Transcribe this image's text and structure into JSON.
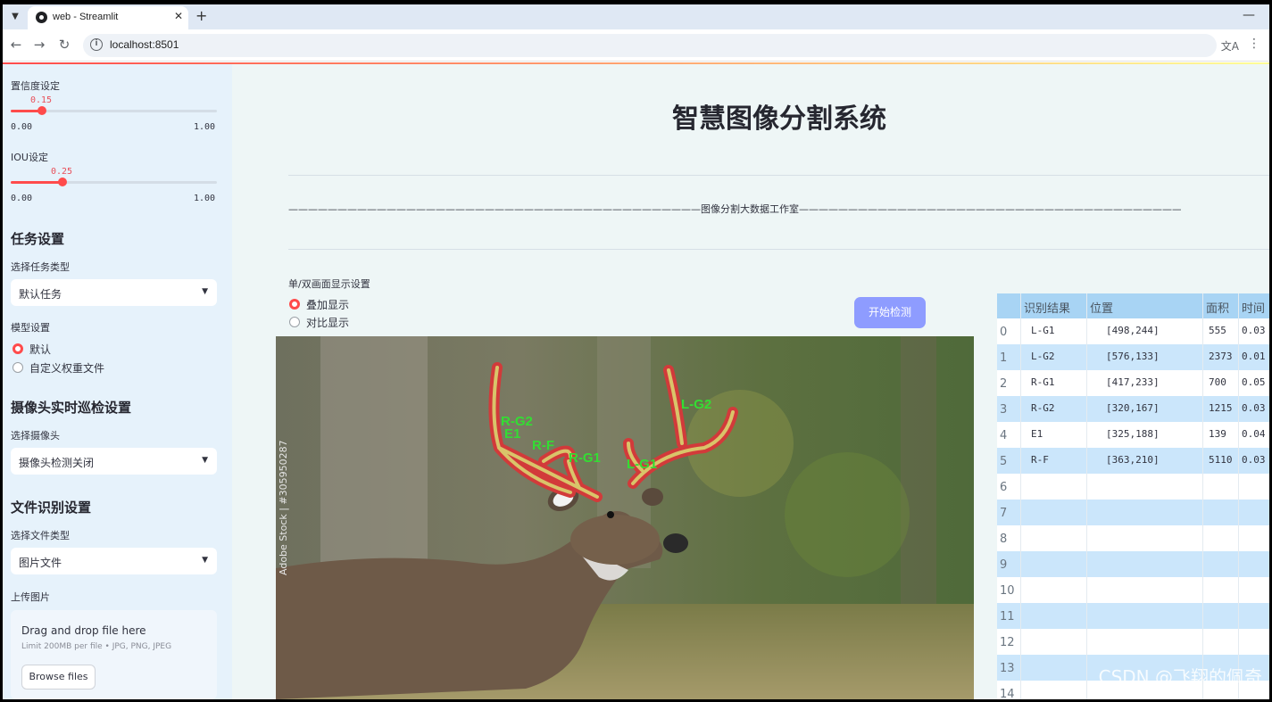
{
  "browser": {
    "tab_title": "web - Streamlit",
    "url": "localhost:8501"
  },
  "sidebar": {
    "conf_label": "置信度设定",
    "conf_value": "0.15",
    "conf_fraction": 0.15,
    "conf_min": "0.00",
    "conf_max": "1.00",
    "iou_label": "IOU设定",
    "iou_value": "0.25",
    "iou_fraction": 0.25,
    "iou_min": "0.00",
    "iou_max": "1.00",
    "task_heading": "任务设置",
    "task_type_label": "选择任务类型",
    "task_type_value": "默认任务",
    "model_label": "模型设置",
    "model_opt1": "默认",
    "model_opt2": "自定义权重文件",
    "camera_heading": "摄像头实时巡检设置",
    "camera_label": "选择摄像头",
    "camera_value": "摄像头检测关闭",
    "file_heading": "文件识别设置",
    "file_type_label": "选择文件类型",
    "file_type_value": "图片文件",
    "upload_label": "上传图片",
    "drop_text": "Drag and drop file here",
    "drop_limit": "Limit 200MB per file • JPG, PNG, JPEG",
    "browse_label": "Browse files"
  },
  "main": {
    "title": "智慧图像分割系统",
    "divider": "——————————————————————————————————————————图像分割大数据工作室——————————————————————————————————————————",
    "display_mode_label": "单/双画面显示设置",
    "mode_opt1": "叠加显示",
    "mode_opt2": "对比显示",
    "detect_button": "开始检测",
    "stock_id": "Adobe Stock | #305950287",
    "labels": [
      "R-G2",
      "E1",
      "R-F",
      "R-G1",
      "L-G1",
      "L-G2"
    ]
  },
  "table": {
    "headers": [
      "识别结果",
      "位置",
      "面积",
      "时间"
    ],
    "rows": [
      {
        "idx": "0",
        "cls": "L-G1",
        "pos": "[498,244]",
        "area": "555",
        "time": "0.03"
      },
      {
        "idx": "1",
        "cls": "L-G2",
        "pos": "[576,133]",
        "area": "2373",
        "time": "0.01"
      },
      {
        "idx": "2",
        "cls": "R-G1",
        "pos": "[417,233]",
        "area": "700",
        "time": "0.05"
      },
      {
        "idx": "3",
        "cls": "R-G2",
        "pos": "[320,167]",
        "area": "1215",
        "time": "0.03"
      },
      {
        "idx": "4",
        "cls": "E1",
        "pos": "[325,188]",
        "area": "139",
        "time": "0.04"
      },
      {
        "idx": "5",
        "cls": "R-F",
        "pos": "[363,210]",
        "area": "5110",
        "time": "0.03"
      },
      {
        "idx": "6",
        "cls": "",
        "pos": "",
        "area": "",
        "time": ""
      },
      {
        "idx": "7",
        "cls": "",
        "pos": "",
        "area": "",
        "time": ""
      },
      {
        "idx": "8",
        "cls": "",
        "pos": "",
        "area": "",
        "time": ""
      },
      {
        "idx": "9",
        "cls": "",
        "pos": "",
        "area": "",
        "time": ""
      },
      {
        "idx": "10",
        "cls": "",
        "pos": "",
        "area": "",
        "time": ""
      },
      {
        "idx": "11",
        "cls": "",
        "pos": "",
        "area": "",
        "time": ""
      },
      {
        "idx": "12",
        "cls": "",
        "pos": "",
        "area": "",
        "time": ""
      },
      {
        "idx": "13",
        "cls": "",
        "pos": "",
        "area": "",
        "time": ""
      },
      {
        "idx": "14",
        "cls": "",
        "pos": "",
        "area": "",
        "time": ""
      }
    ]
  },
  "watermark": "CSDN @飞翔的佩奇",
  "colors": {
    "accent": "#ff4b4b",
    "button": "#8e9cff",
    "table_header": "#a8d4f4",
    "table_alt": "#cbe6fb",
    "mask_outline": "#d23a3a",
    "label_green": "#33dd33"
  }
}
